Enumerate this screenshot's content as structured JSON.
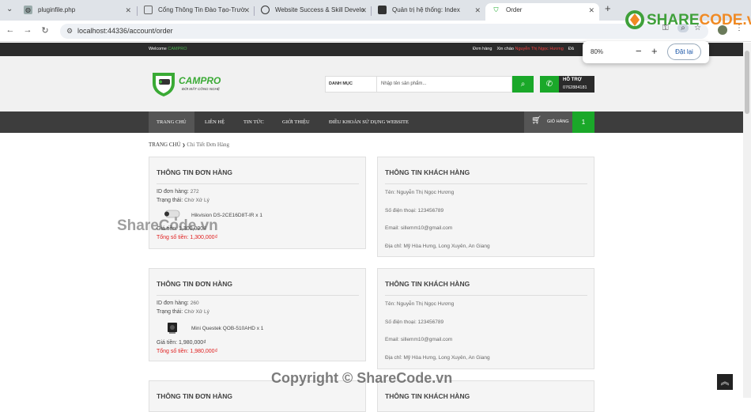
{
  "browser": {
    "tabs": [
      {
        "title": "pluginfile.php",
        "icon": "globe-icon"
      },
      {
        "title": "Cổng Thông Tin Đào Tạo-Trườ",
        "icon": "page-icon"
      },
      {
        "title": "Website Success & Skill Develo",
        "icon": "site-icon"
      },
      {
        "title": "Quản trị hệ thống: Index",
        "icon": "admin-icon"
      },
      {
        "title": "Order",
        "icon": "campro-icon"
      }
    ],
    "new_tab": "+",
    "url": "localhost:44336/account/order",
    "zoom_popup": {
      "percent": "80%",
      "minus": "−",
      "plus": "+",
      "reset": "Đặt lại"
    }
  },
  "site": {
    "topbar": {
      "welcome": "Welcome",
      "brand": "CAMPRO",
      "orders": "Đơn hàng",
      "greeting": "Xin chào",
      "user": "Nguyễn Thị Ngọc Hương",
      "logout": "Đă"
    },
    "logo": {
      "name": "CAMPRO",
      "tagline": "ĐỜI MẮT CÔNG NGHỆ"
    },
    "search": {
      "category": "DANH MỤC",
      "placeholder": "Nhập tên sản phẩm..."
    },
    "support": {
      "label": "HỖ TRỢ",
      "phone": "0762884181"
    },
    "menu": [
      "TRANG CHỦ",
      "LIÊN HỆ",
      "TIN TỨC",
      "GIỚI THIỆU",
      "ĐIỀU KHOẢN SỬ DỤNG WEBSITE"
    ],
    "cart": {
      "label": "GIỎ HÀNG",
      "count": "1"
    },
    "breadcrumb": {
      "home": "TRANG CHỦ",
      "sep": "❯",
      "current": "Chi Tiết Đơn Hàng"
    },
    "orders": [
      {
        "title": "THÔNG TIN ĐƠN HÀNG",
        "id_label": "ID đơn hàng:",
        "id": "272",
        "status_label": "Trạng thái:",
        "status": "Chờ Xử Lý",
        "product": "Hikvision DS-2CE16D8T-IR x 1",
        "price_label": "Giá tiền:",
        "price": "1,300,000₫",
        "total_label": "Tổng số tiền:",
        "total": "1,300,000₫",
        "customer": {
          "title": "THÔNG TIN KHÁCH HÀNG",
          "name": "Tên: Nguyễn Thị Ngọc Hương",
          "phone": "Số điện thoại: 123456789",
          "email": "Email: sillemm10@gmail.com",
          "address": "Địa chỉ: Mỹ Hòa Hưng, Long Xuyên, An Giang"
        }
      },
      {
        "title": "THÔNG TIN ĐƠN HÀNG",
        "id_label": "ID đơn hàng:",
        "id": "260",
        "status_label": "Trạng thái:",
        "status": "Chờ Xử Lý",
        "product": "Mini Questek QOB-510AHD x 1",
        "price_label": "Giá tiền:",
        "price": "1,980,000₫",
        "total_label": "Tổng số tiền:",
        "total": "1,980,000₫",
        "customer": {
          "title": "THÔNG TIN KHÁCH HÀNG",
          "name": "Tên: Nguyễn Thị Ngọc Hương",
          "phone": "Số điện thoại: 123456789",
          "email": "Email: sillemm10@gmail.com",
          "address": "Địa chỉ: Mỹ Hòa Hưng, Long Xuyên, An Giang"
        }
      },
      {
        "title": "THÔNG TIN ĐƠN HÀNG",
        "customer": {
          "title": "THÔNG TIN KHÁCH HÀNG"
        }
      }
    ]
  },
  "watermarks": {
    "center": "ShareCode.vn",
    "bottom": "Copyright © ShareCode.vn"
  },
  "brand_logo": {
    "share": "SHARE",
    "code": "CODE.vn"
  },
  "colors": {
    "green": "#1aa829",
    "dark": "#2b2b2b",
    "red_total": "#e02020"
  }
}
